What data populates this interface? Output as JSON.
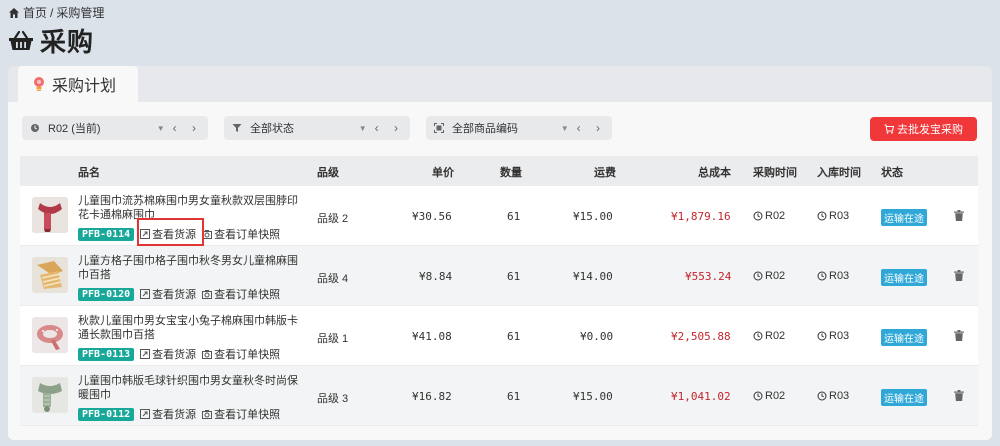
{
  "breadcrumb": {
    "home": "首页",
    "sep": "/",
    "current": "采购管理"
  },
  "page": {
    "title": "采购"
  },
  "tab": {
    "label": "采购计划"
  },
  "filters": {
    "round": "R02 (当前)",
    "status": "全部状态",
    "sku": "全部商品编码",
    "caret": "▼",
    "nav": "‹ ›"
  },
  "actions": {
    "purchase_button": "去批发宝采购"
  },
  "table": {
    "headers": {
      "name": "品名",
      "grade": "品级",
      "price": "单价",
      "qty": "数量",
      "freight": "运费",
      "total": "总成本",
      "buy_time": "采购时间",
      "stock_time": "入库时间",
      "status": "状态"
    },
    "link_source": "查看货源",
    "link_snapshot": "查看订单快照",
    "rows": [
      {
        "name": "儿童围巾流苏棉麻围巾男女童秋款双层围脖印花卡通棉麻围巾",
        "sku": "PFB-0114",
        "grade": "品级 2",
        "price": "¥30.56",
        "qty": "61",
        "freight": "¥15.00",
        "total": "¥1,879.16",
        "buy_time": "R02",
        "stock_time": "R03",
        "status": "运输在途"
      },
      {
        "name": "儿童方格子围巾格子围巾秋冬男女儿童棉麻围巾百搭",
        "sku": "PFB-0120",
        "grade": "品级 4",
        "price": "¥8.84",
        "qty": "61",
        "freight": "¥14.00",
        "total": "¥553.24",
        "buy_time": "R02",
        "stock_time": "R03",
        "status": "运输在途"
      },
      {
        "name": "秋款儿童围巾男女宝宝小兔子棉麻围巾韩版卡通长款围巾百搭",
        "sku": "PFB-0113",
        "grade": "品级 1",
        "price": "¥41.08",
        "qty": "61",
        "freight": "¥0.00",
        "total": "¥2,505.88",
        "buy_time": "R02",
        "stock_time": "R03",
        "status": "运输在途"
      },
      {
        "name": "儿童围巾韩版毛球针织围巾男女童秋冬时尚保暖围巾",
        "sku": "PFB-0112",
        "grade": "品级 3",
        "price": "¥16.82",
        "qty": "61",
        "freight": "¥15.00",
        "total": "¥1,041.02",
        "buy_time": "R02",
        "stock_time": "R03",
        "status": "运输在途"
      }
    ]
  },
  "colors": {
    "accent_red": "#f0373a",
    "sku_teal": "#17a89a",
    "status_blue": "#2fa8d7",
    "total_red": "#c2262c"
  }
}
